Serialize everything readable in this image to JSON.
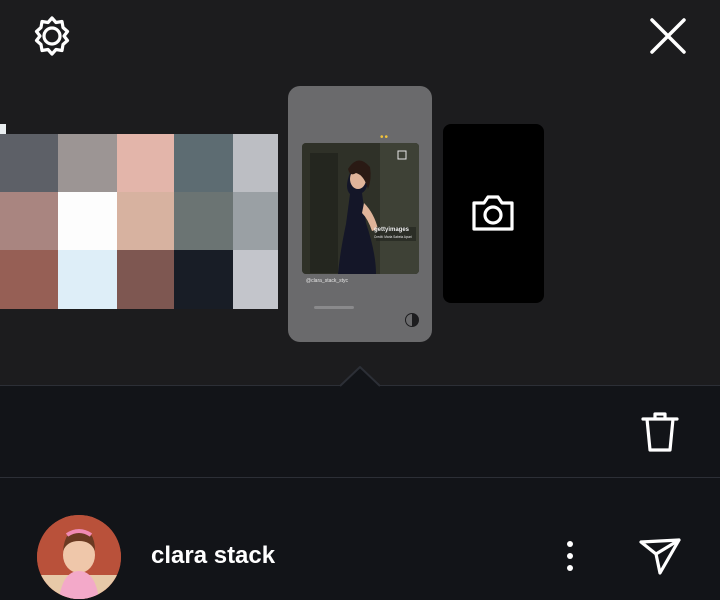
{
  "header": {
    "settings_icon": "gear-icon",
    "close_icon": "close-icon"
  },
  "stories": {
    "palette_colors": [
      "#5d6067",
      "#9c9594",
      "#e3b5aa",
      "#5d6c72",
      "#bcbec3",
      "#a98580",
      "#fdfdfd",
      "#d7b2a0",
      "#6b7473",
      "#9aa0a4",
      "#965f55",
      "#deeef8",
      "#7e5751",
      "#181d26",
      "#c3c5cb"
    ],
    "selected": {
      "dots": "••",
      "photo_watermark": "gettyimages",
      "photo_credit": "Credit: Marla Sabela Apuni",
      "handle": "@clara_stack_styc"
    },
    "camera_icon": "camera-icon"
  },
  "actions": {
    "delete_icon": "trash-icon"
  },
  "viewer": {
    "name": "clara stack",
    "more_icon": "more-vertical-icon",
    "send_icon": "send-icon"
  },
  "colors": {
    "background": "#1c1c1e",
    "panel": "#121418",
    "accent_dots": "#f1c33a"
  }
}
